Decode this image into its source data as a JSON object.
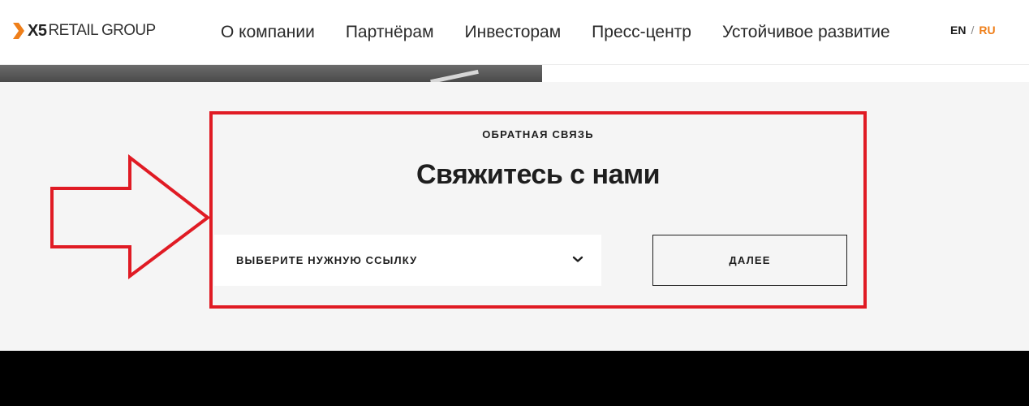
{
  "header": {
    "logo": {
      "mark": "X5",
      "text": "RETAIL GROUP",
      "accent_color": "#ef7f1a"
    },
    "nav": [
      {
        "label": "О компании"
      },
      {
        "label": "Партнёрам"
      },
      {
        "label": "Инвесторам"
      },
      {
        "label": "Пресс-центр"
      },
      {
        "label": "Устойчивое развитие"
      }
    ],
    "lang": {
      "en": "EN",
      "separator": "/",
      "ru": "RU",
      "active": "RU",
      "active_color": "#ef7f1a"
    }
  },
  "feedback": {
    "eyebrow": "ОБРАТНАЯ СВЯЗЬ",
    "title": "Свяжитесь с нами",
    "select": {
      "value": "ВЫБЕРИТЕ НУЖНУЮ ССЫЛКУ",
      "icon": "chevron-down-icon"
    },
    "next_button": "ДАЛЕЕ"
  },
  "annotation": {
    "highlight_color": "#e01b24",
    "arrow_icon": "arrow-right-icon"
  }
}
